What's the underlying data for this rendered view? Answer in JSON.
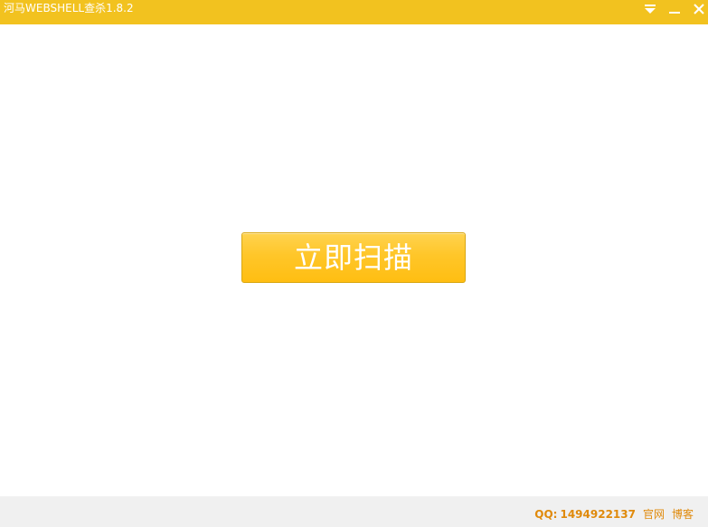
{
  "window": {
    "title": "河马WEBSHELL查杀1.8.2",
    "title_color": "#ffffff",
    "titlebar_color": "#f2c21f",
    "controls": {
      "menu_icon": "dropdown-menu-icon",
      "minimize_icon": "minimize-icon",
      "close_icon": "close-icon"
    }
  },
  "main": {
    "scan_button_label": "立即扫描",
    "scan_button_color": "#ffc629"
  },
  "footer": {
    "qq_label": "QQ:",
    "qq_number": "1494922137",
    "official_site_label": "官网",
    "blog_label": "博客",
    "link_color": "#e08a0b",
    "background_color": "#f0f0f0"
  }
}
